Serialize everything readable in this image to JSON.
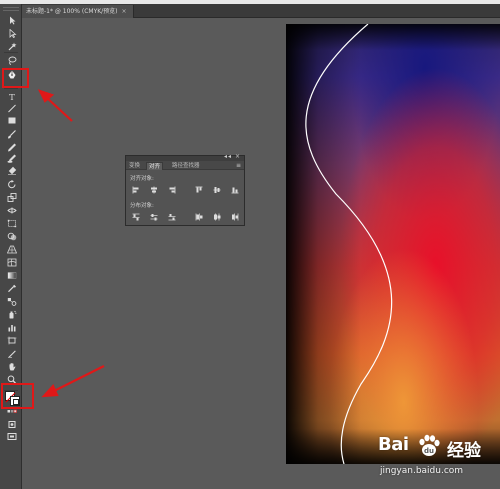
{
  "document": {
    "tab_title": "未标题-1* @ 100% (CMYK/预览)",
    "close_glyph": "×"
  },
  "tools": [
    {
      "name": "selection-tool-icon"
    },
    {
      "name": "direct-selection-tool-icon"
    },
    {
      "name": "magic-wand-tool-icon"
    },
    {
      "name": "lasso-tool-icon"
    },
    {
      "name": "pen-tool-icon"
    },
    {
      "name": "type-tool-icon"
    },
    {
      "name": "line-segment-tool-icon"
    },
    {
      "name": "rectangle-tool-icon"
    },
    {
      "name": "paintbrush-tool-icon"
    },
    {
      "name": "pencil-tool-icon"
    },
    {
      "name": "blob-brush-tool-icon"
    },
    {
      "name": "eraser-tool-icon"
    },
    {
      "name": "rotate-tool-icon"
    },
    {
      "name": "scale-tool-icon"
    },
    {
      "name": "width-tool-icon"
    },
    {
      "name": "free-transform-tool-icon"
    },
    {
      "name": "shape-builder-tool-icon"
    },
    {
      "name": "perspective-grid-tool-icon"
    },
    {
      "name": "mesh-tool-icon"
    },
    {
      "name": "gradient-tool-icon"
    },
    {
      "name": "eyedropper-tool-icon"
    },
    {
      "name": "blend-tool-icon"
    },
    {
      "name": "symbol-sprayer-tool-icon"
    },
    {
      "name": "column-graph-tool-icon"
    },
    {
      "name": "artboard-tool-icon"
    },
    {
      "name": "slice-tool-icon"
    },
    {
      "name": "hand-tool-icon"
    },
    {
      "name": "zoom-tool-icon"
    }
  ],
  "colors": {
    "highlight": "#e01818",
    "artboard_top": "#1a1a8a",
    "artboard_mid": "#e01020",
    "artboard_bottom": "#e89030"
  },
  "align_panel": {
    "tabs": [
      "变换",
      "对齐",
      "路径查找器"
    ],
    "active_tab_index": 1,
    "menu_glyph": "≡",
    "header_controls": "◂◂ ×",
    "align_objects_label": "对齐对象:",
    "distribute_objects_label": "分布对象:",
    "align_buttons": [
      "align-left-icon",
      "align-horizontal-center-icon",
      "align-right-icon",
      "align-top-icon",
      "align-vertical-center-icon",
      "align-bottom-icon"
    ],
    "distribute_buttons": [
      "distribute-top-icon",
      "distribute-vertical-center-icon",
      "distribute-bottom-icon",
      "distribute-left-icon",
      "distribute-horizontal-center-icon",
      "distribute-right-icon"
    ]
  },
  "watermark": {
    "logo_text": "Bai",
    "brand_text": "经验",
    "url": "jingyan.baidu.com"
  }
}
